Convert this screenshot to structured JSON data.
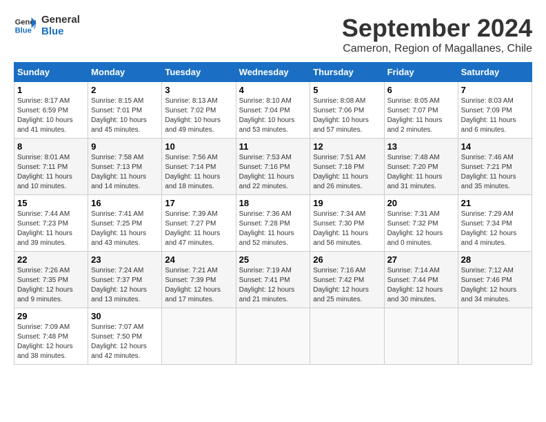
{
  "logo": {
    "line1": "General",
    "line2": "Blue"
  },
  "title": "September 2024",
  "location": "Cameron, Region of Magallanes, Chile",
  "weekdays": [
    "Sunday",
    "Monday",
    "Tuesday",
    "Wednesday",
    "Thursday",
    "Friday",
    "Saturday"
  ],
  "weeks": [
    [
      {
        "day": "1",
        "sunrise": "Sunrise: 8:17 AM",
        "sunset": "Sunset: 6:59 PM",
        "daylight": "Daylight: 10 hours and 41 minutes."
      },
      {
        "day": "2",
        "sunrise": "Sunrise: 8:15 AM",
        "sunset": "Sunset: 7:01 PM",
        "daylight": "Daylight: 10 hours and 45 minutes."
      },
      {
        "day": "3",
        "sunrise": "Sunrise: 8:13 AM",
        "sunset": "Sunset: 7:02 PM",
        "daylight": "Daylight: 10 hours and 49 minutes."
      },
      {
        "day": "4",
        "sunrise": "Sunrise: 8:10 AM",
        "sunset": "Sunset: 7:04 PM",
        "daylight": "Daylight: 10 hours and 53 minutes."
      },
      {
        "day": "5",
        "sunrise": "Sunrise: 8:08 AM",
        "sunset": "Sunset: 7:06 PM",
        "daylight": "Daylight: 10 hours and 57 minutes."
      },
      {
        "day": "6",
        "sunrise": "Sunrise: 8:05 AM",
        "sunset": "Sunset: 7:07 PM",
        "daylight": "Daylight: 11 hours and 2 minutes."
      },
      {
        "day": "7",
        "sunrise": "Sunrise: 8:03 AM",
        "sunset": "Sunset: 7:09 PM",
        "daylight": "Daylight: 11 hours and 6 minutes."
      }
    ],
    [
      {
        "day": "8",
        "sunrise": "Sunrise: 8:01 AM",
        "sunset": "Sunset: 7:11 PM",
        "daylight": "Daylight: 11 hours and 10 minutes."
      },
      {
        "day": "9",
        "sunrise": "Sunrise: 7:58 AM",
        "sunset": "Sunset: 7:13 PM",
        "daylight": "Daylight: 11 hours and 14 minutes."
      },
      {
        "day": "10",
        "sunrise": "Sunrise: 7:56 AM",
        "sunset": "Sunset: 7:14 PM",
        "daylight": "Daylight: 11 hours and 18 minutes."
      },
      {
        "day": "11",
        "sunrise": "Sunrise: 7:53 AM",
        "sunset": "Sunset: 7:16 PM",
        "daylight": "Daylight: 11 hours and 22 minutes."
      },
      {
        "day": "12",
        "sunrise": "Sunrise: 7:51 AM",
        "sunset": "Sunset: 7:18 PM",
        "daylight": "Daylight: 11 hours and 26 minutes."
      },
      {
        "day": "13",
        "sunrise": "Sunrise: 7:48 AM",
        "sunset": "Sunset: 7:20 PM",
        "daylight": "Daylight: 11 hours and 31 minutes."
      },
      {
        "day": "14",
        "sunrise": "Sunrise: 7:46 AM",
        "sunset": "Sunset: 7:21 PM",
        "daylight": "Daylight: 11 hours and 35 minutes."
      }
    ],
    [
      {
        "day": "15",
        "sunrise": "Sunrise: 7:44 AM",
        "sunset": "Sunset: 7:23 PM",
        "daylight": "Daylight: 11 hours and 39 minutes."
      },
      {
        "day": "16",
        "sunrise": "Sunrise: 7:41 AM",
        "sunset": "Sunset: 7:25 PM",
        "daylight": "Daylight: 11 hours and 43 minutes."
      },
      {
        "day": "17",
        "sunrise": "Sunrise: 7:39 AM",
        "sunset": "Sunset: 7:27 PM",
        "daylight": "Daylight: 11 hours and 47 minutes."
      },
      {
        "day": "18",
        "sunrise": "Sunrise: 7:36 AM",
        "sunset": "Sunset: 7:28 PM",
        "daylight": "Daylight: 11 hours and 52 minutes."
      },
      {
        "day": "19",
        "sunrise": "Sunrise: 7:34 AM",
        "sunset": "Sunset: 7:30 PM",
        "daylight": "Daylight: 11 hours and 56 minutes."
      },
      {
        "day": "20",
        "sunrise": "Sunrise: 7:31 AM",
        "sunset": "Sunset: 7:32 PM",
        "daylight": "Daylight: 12 hours and 0 minutes."
      },
      {
        "day": "21",
        "sunrise": "Sunrise: 7:29 AM",
        "sunset": "Sunset: 7:34 PM",
        "daylight": "Daylight: 12 hours and 4 minutes."
      }
    ],
    [
      {
        "day": "22",
        "sunrise": "Sunrise: 7:26 AM",
        "sunset": "Sunset: 7:35 PM",
        "daylight": "Daylight: 12 hours and 9 minutes."
      },
      {
        "day": "23",
        "sunrise": "Sunrise: 7:24 AM",
        "sunset": "Sunset: 7:37 PM",
        "daylight": "Daylight: 12 hours and 13 minutes."
      },
      {
        "day": "24",
        "sunrise": "Sunrise: 7:21 AM",
        "sunset": "Sunset: 7:39 PM",
        "daylight": "Daylight: 12 hours and 17 minutes."
      },
      {
        "day": "25",
        "sunrise": "Sunrise: 7:19 AM",
        "sunset": "Sunset: 7:41 PM",
        "daylight": "Daylight: 12 hours and 21 minutes."
      },
      {
        "day": "26",
        "sunrise": "Sunrise: 7:16 AM",
        "sunset": "Sunset: 7:42 PM",
        "daylight": "Daylight: 12 hours and 25 minutes."
      },
      {
        "day": "27",
        "sunrise": "Sunrise: 7:14 AM",
        "sunset": "Sunset: 7:44 PM",
        "daylight": "Daylight: 12 hours and 30 minutes."
      },
      {
        "day": "28",
        "sunrise": "Sunrise: 7:12 AM",
        "sunset": "Sunset: 7:46 PM",
        "daylight": "Daylight: 12 hours and 34 minutes."
      }
    ],
    [
      {
        "day": "29",
        "sunrise": "Sunrise: 7:09 AM",
        "sunset": "Sunset: 7:48 PM",
        "daylight": "Daylight: 12 hours and 38 minutes."
      },
      {
        "day": "30",
        "sunrise": "Sunrise: 7:07 AM",
        "sunset": "Sunset: 7:50 PM",
        "daylight": "Daylight: 12 hours and 42 minutes."
      },
      null,
      null,
      null,
      null,
      null
    ]
  ]
}
